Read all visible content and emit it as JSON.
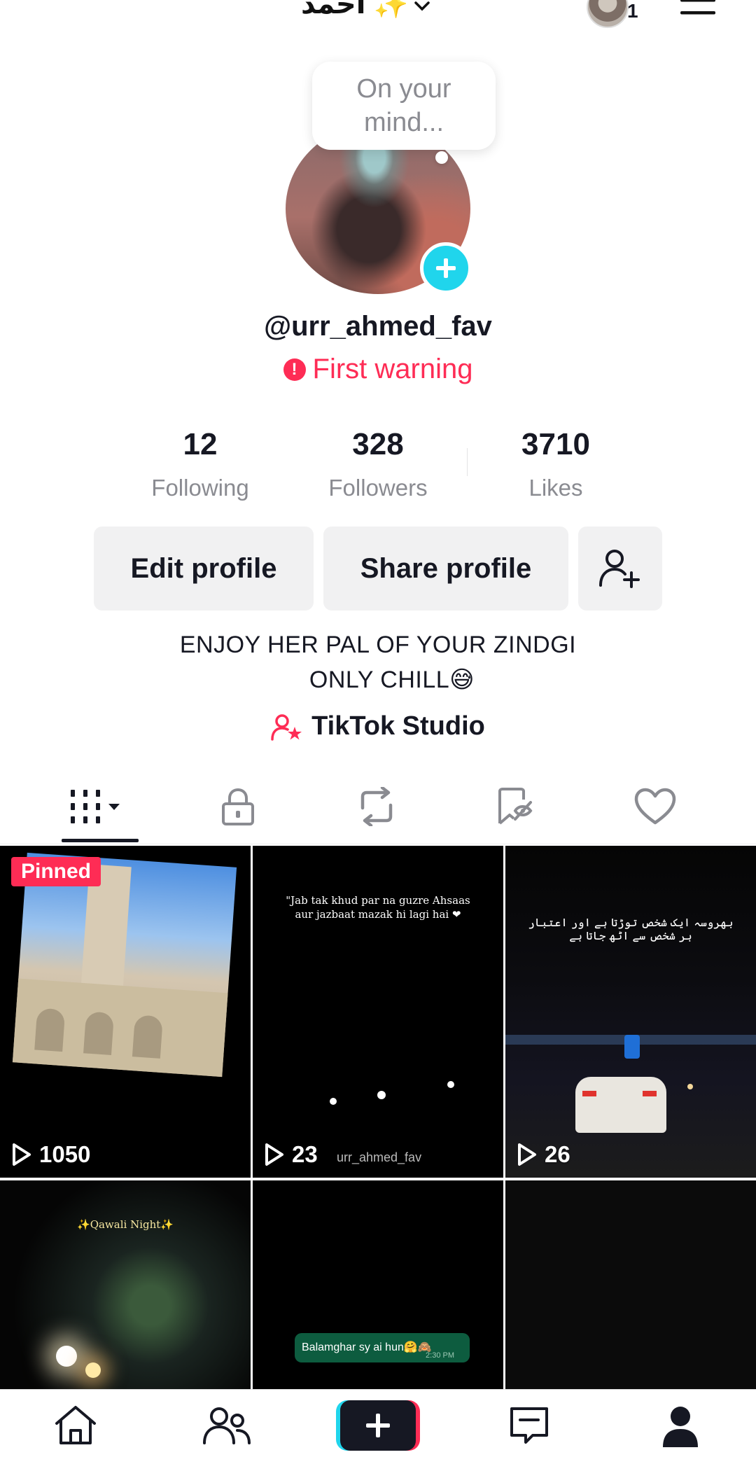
{
  "header": {
    "account_name": "احمد ✨",
    "notification_count": "1"
  },
  "profile": {
    "bubble_text": "On your mind...",
    "username": "@urr_ahmed_fav",
    "warning_text": "First warning"
  },
  "stats": [
    {
      "value": "12",
      "label": "Following"
    },
    {
      "value": "328",
      "label": "Followers"
    },
    {
      "value": "3710",
      "label": "Likes"
    }
  ],
  "actions": {
    "edit_label": "Edit profile",
    "share_label": "Share profile"
  },
  "bio": {
    "line1": "ENJOY HER PAL OF YOUR ZINDGI",
    "line2": "ONLY CHILL😅"
  },
  "studio_label": "TikTok Studio",
  "tabs": [
    "videos-grid-icon",
    "lock-icon",
    "repost-icon",
    "favorites-icon",
    "liked-heart-icon"
  ],
  "videos": [
    {
      "pinned_label": "Pinned",
      "views": "1050",
      "caption": ""
    },
    {
      "views": "23",
      "caption": "\"Jab tak khud par na guzre Ahsaas aur jazbaat mazak hi lagi hai ❤",
      "watermark": "urr_ahmed_fav"
    },
    {
      "views": "26",
      "caption": "بھروسہ ایک شخص توڑتا ہے اور اعتبار ہر شخص سے اٹھ جاتا ہے"
    },
    {
      "caption": "✨Qawali Night✨"
    },
    {
      "chat_text": "Balamghar sy ai hun🤗🙈",
      "chat_time": "2:30 PM"
    },
    {}
  ],
  "colors": {
    "accent": "#fe2c55",
    "cyan": "#20d5ec",
    "text": "#161823",
    "muted": "#8a8b91"
  },
  "nav": [
    "home-icon",
    "friends-icon",
    "create-icon",
    "inbox-icon",
    "profile-icon"
  ]
}
